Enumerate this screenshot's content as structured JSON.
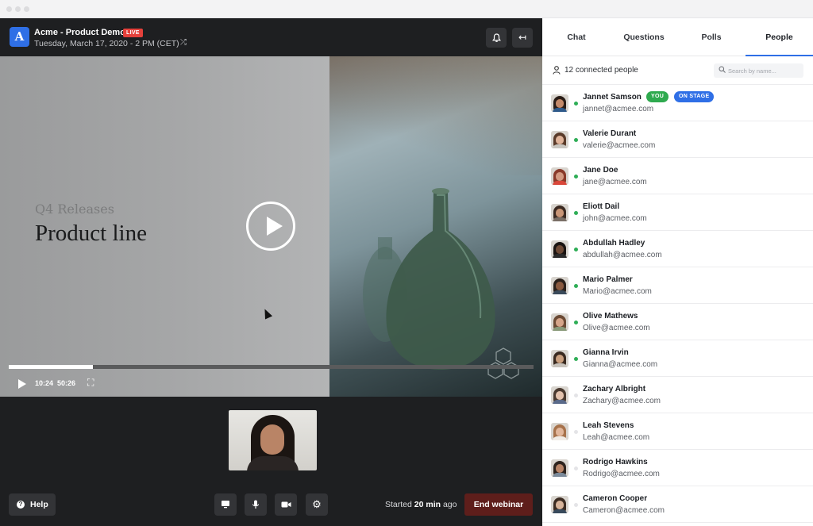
{
  "header": {
    "logo_letter": "A",
    "title": "Acme - Product Demo",
    "live_badge": "LIVE",
    "subtitle": "Tuesday, March 17, 2020 - 2 PM (CET)",
    "icons": [
      "shuffle-icon",
      "bell-icon",
      "collapse-panel-icon"
    ]
  },
  "video": {
    "kicker": "Q4  Releases",
    "headline": "Product line",
    "elapsed": "10:24",
    "duration": "50:26",
    "progress": 0.16
  },
  "controls": {
    "help_label": "Help",
    "icons": [
      "screen-share-icon",
      "microphone-icon",
      "camera-icon",
      "settings-icon"
    ],
    "started_prefix": "Started",
    "started_value": "20 min",
    "started_suffix": "ago",
    "end_label": "End webinar"
  },
  "panel": {
    "tabs": [
      "Chat",
      "Questions",
      "Polls",
      "People"
    ],
    "active_tab": "People",
    "connected": "12 connected people",
    "search_placeholder": "Search by name..."
  },
  "badges": {
    "you": "YOU",
    "on_stage": "ON STAGE"
  },
  "colors": {
    "accent": "#2f6fe6",
    "live": "#e5413b",
    "online": "#2fae57",
    "offline": "#e4e4e7",
    "you_badge": "#2faa4f",
    "stage_badge": "#2f6fe6"
  },
  "people": [
    {
      "name": "Jannet Samson",
      "email": "jannet@acmee.com",
      "online": true,
      "you": true,
      "on_stage": true
    },
    {
      "name": "Valerie Durant",
      "email": "valerie@acmee.com",
      "online": true
    },
    {
      "name": "Jane Doe",
      "email": "jane@acmee.com",
      "online": true
    },
    {
      "name": "Eliott Dail",
      "email": "john@acmee.com",
      "online": true
    },
    {
      "name": "Abdullah Hadley",
      "email": "abdullah@acmee.com",
      "online": true
    },
    {
      "name": "Mario Palmer",
      "email": "Mario@acmee.com",
      "online": true
    },
    {
      "name": "Olive Mathews",
      "email": "Olive@acmee.com",
      "online": true
    },
    {
      "name": "Gianna Irvin",
      "email": "Gianna@acmee.com",
      "online": true
    },
    {
      "name": "Zachary Albright",
      "email": "Zachary@acmee.com",
      "online": false
    },
    {
      "name": "Leah Stevens",
      "email": "Leah@acmee.com",
      "online": false
    },
    {
      "name": "Rodrigo Hawkins",
      "email": "Rodrigo@acmee.com",
      "online": false
    },
    {
      "name": "Cameron Cooper",
      "email": "Cameron@acmee.com",
      "online": false
    }
  ]
}
